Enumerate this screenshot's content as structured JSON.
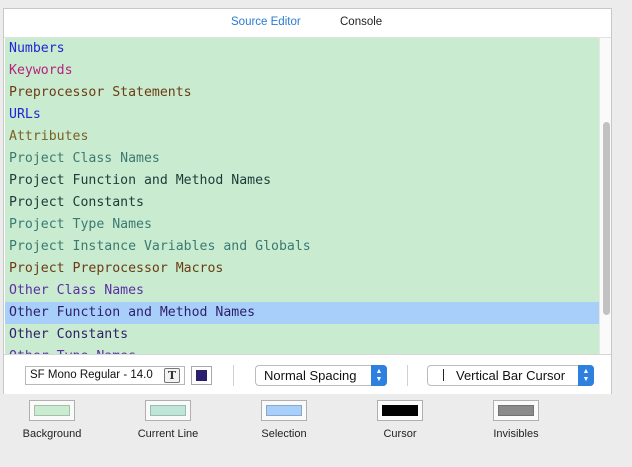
{
  "tabs": [
    {
      "label": "Source Editor",
      "active": true
    },
    {
      "label": "Console",
      "active": false
    }
  ],
  "syntax_items": [
    {
      "label": "Numbers",
      "color": "#1f26d6"
    },
    {
      "label": "Keywords",
      "color": "#b5237e"
    },
    {
      "label": "Preprocessor Statements",
      "color": "#6b3c16"
    },
    {
      "label": "URLs",
      "color": "#1f26d6"
    },
    {
      "label": "Attributes",
      "color": "#7a6224"
    },
    {
      "label": "Project Class Names",
      "color": "#3b7a73"
    },
    {
      "label": "Project Function and Method Names",
      "color": "#1d3b3a"
    },
    {
      "label": "Project Constants",
      "color": "#1d3b3a"
    },
    {
      "label": "Project Type Names",
      "color": "#3b7a73"
    },
    {
      "label": "Project Instance Variables and Globals",
      "color": "#3b7a73"
    },
    {
      "label": "Project Preprocessor Macros",
      "color": "#6b3c16"
    },
    {
      "label": "Other Class Names",
      "color": "#5b2fa8"
    },
    {
      "label": "Other Function and Method Names",
      "color": "#2f1f6b",
      "selected": true
    },
    {
      "label": "Other Constants",
      "color": "#2f1f6b"
    },
    {
      "label": "Other Type Names",
      "color": "#5b2fa8"
    }
  ],
  "toolbar": {
    "font_value": "SF Mono Regular - 14.0",
    "font_button_glyph": "T",
    "color_swatch": "#2c1f6b",
    "spacing_value": "Normal Spacing",
    "cursor_value": "Vertical Bar Cursor"
  },
  "color_wells": [
    {
      "label": "Background",
      "color": "#c9ebcf"
    },
    {
      "label": "Current Line",
      "color": "#bfe5d9"
    },
    {
      "label": "Selection",
      "color": "#a7cffa"
    },
    {
      "label": "Cursor",
      "color": "#000000"
    },
    {
      "label": "Invisibles",
      "color": "#8a8a8a"
    }
  ]
}
